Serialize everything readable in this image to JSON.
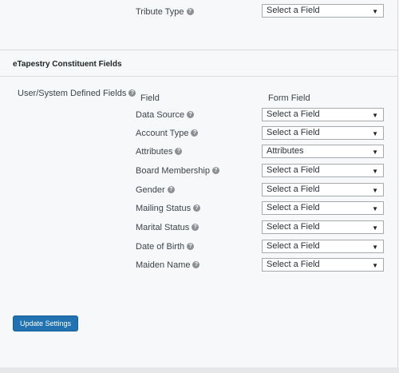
{
  "top_row": {
    "label": "Tribute Type",
    "value": "Select a Field"
  },
  "section": {
    "title": "eTapestry Constituent Fields",
    "group_label": "User/System Defined Fields",
    "col_field": "Field",
    "col_form_field": "Form Field"
  },
  "rows": [
    {
      "label": "Data Source",
      "value": "Select a Field"
    },
    {
      "label": "Account Type",
      "value": "Select a Field"
    },
    {
      "label": "Attributes",
      "value": "Attributes"
    },
    {
      "label": "Board Membership",
      "value": "Select a Field"
    },
    {
      "label": "Gender",
      "value": "Select a Field"
    },
    {
      "label": "Mailing Status",
      "value": "Select a Field"
    },
    {
      "label": "Marital Status",
      "value": "Select a Field"
    },
    {
      "label": "Date of Birth",
      "value": "Select a Field"
    },
    {
      "label": "Maiden Name",
      "value": "Select a Field"
    }
  ],
  "button": {
    "label": "Update Settings"
  },
  "icons": {
    "help": "question-circle-icon",
    "dropdown": "chevron-down-icon"
  },
  "colors": {
    "primary": "#2271b1"
  }
}
